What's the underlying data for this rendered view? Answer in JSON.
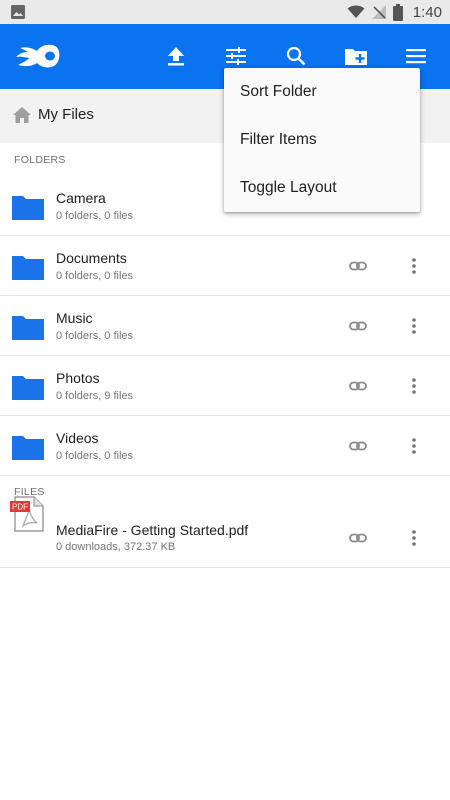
{
  "status_bar": {
    "time": "1:40",
    "icons": [
      "image-icon",
      "wifi-icon",
      "no-signal-icon",
      "battery-icon"
    ]
  },
  "toolbar": {
    "background": "#0a73f0",
    "icons": [
      "mediafire-logo-icon",
      "upload-icon",
      "filter-sliders-icon",
      "search-icon",
      "new-folder-icon",
      "menu-icon"
    ]
  },
  "breadcrumb": {
    "path": "My Files"
  },
  "sections": {
    "folders_label": "FOLDERS",
    "files_label": "FILES"
  },
  "folders": [
    {
      "name": "Camera",
      "meta": "0 folders, 0 files"
    },
    {
      "name": "Documents",
      "meta": "0 folders, 0 files"
    },
    {
      "name": "Music",
      "meta": "0 folders, 0 files"
    },
    {
      "name": "Photos",
      "meta": "0 folders, 9 files"
    },
    {
      "name": "Videos",
      "meta": "0 folders, 0 files"
    }
  ],
  "files": [
    {
      "name": "MediaFire - Getting Started.pdf",
      "meta": "0 downloads, 372.37 KB",
      "badge": "PDF"
    }
  ],
  "overflow_menu": {
    "items": [
      "Sort Folder",
      "Filter Items",
      "Toggle Layout"
    ]
  },
  "colors": {
    "accent": "#0a73f0",
    "folder": "#1a73e8",
    "pdf_badge": "#e53935"
  }
}
